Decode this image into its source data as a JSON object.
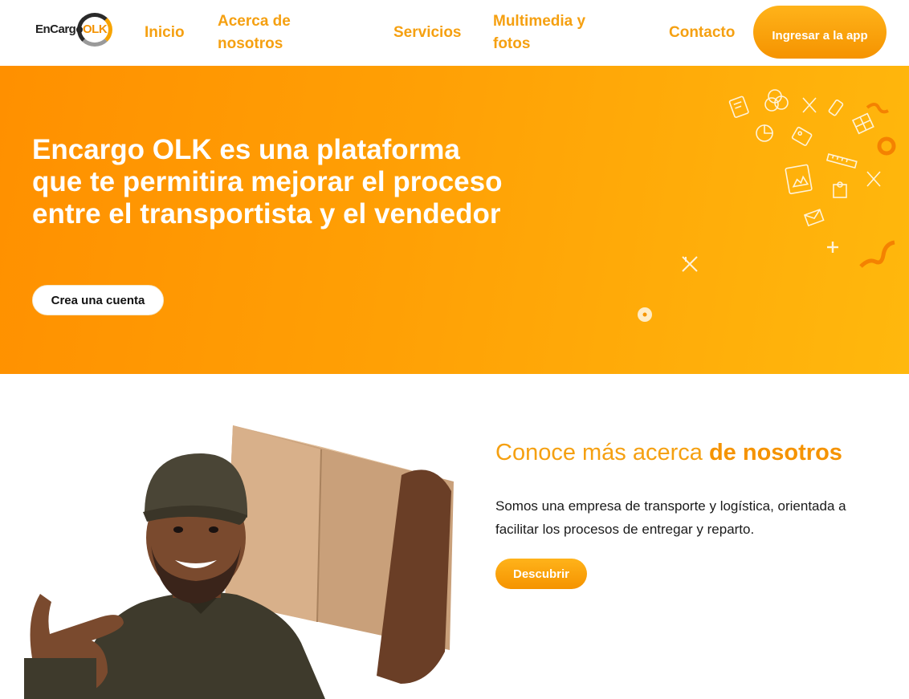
{
  "brand": {
    "logo_prefix": "EnCargo",
    "logo_suffix": "OLK"
  },
  "nav": {
    "links": [
      "Inicio",
      "Acerca de nosotros",
      "Servicios",
      "Multimedia y fotos",
      "Contacto"
    ],
    "app_button": "Ingresar a la app"
  },
  "hero": {
    "title": "Encargo OLK es una plataforma que te permitira mejorar el proceso entre el transportista y el vendedor",
    "cta": "Crea una cuenta"
  },
  "about": {
    "title_light": "Conoce más acerca",
    "title_bold": "de nosotros",
    "text": "Somos una empresa de transporte y logística, orientada a facilitar los procesos de entregar y reparto.",
    "button": "Descubrir"
  },
  "colors": {
    "brand_orange": "#f59300",
    "nav_text": "#f5a011",
    "hero_start": "#ff9000",
    "hero_end": "#ffb80d"
  }
}
